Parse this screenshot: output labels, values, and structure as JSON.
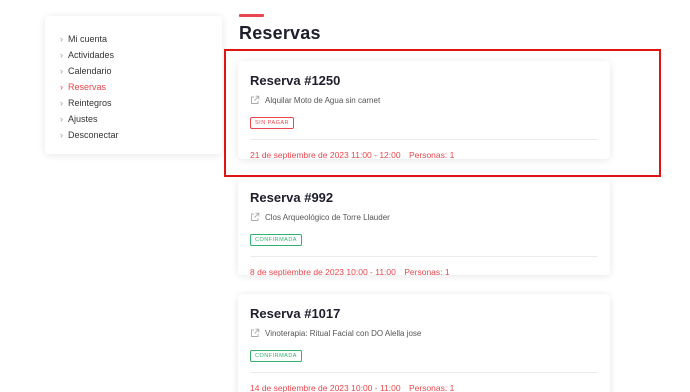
{
  "sidebar": {
    "items": [
      {
        "label": "Mi cuenta"
      },
      {
        "label": "Actividades"
      },
      {
        "label": "Calendario"
      },
      {
        "label": "Reservas"
      },
      {
        "label": "Reintegros"
      },
      {
        "label": "Ajustes"
      },
      {
        "label": "Desconectar"
      }
    ],
    "active_index": 3
  },
  "page": {
    "title": "Reservas"
  },
  "reservations": [
    {
      "title": "Reserva #1250",
      "activity": "Alquilar Moto de Agua sin carnet",
      "status": "SIN PAGAR",
      "date": "21 de septiembre de 2023 11:00 - 12:00",
      "persons": "Personas: 1"
    },
    {
      "title": "Reserva #992",
      "activity": "Clos Arqueológico de Torre Llauder",
      "status": "CONFIRMADA",
      "date": "8 de septiembre de 2023 10:00 - 11:00",
      "persons": "Personas: 1"
    },
    {
      "title": "Reserva #1017",
      "activity": "Vinoterapia: Ritual Facial con DO Alella jose",
      "status": "CONFIRMADA",
      "date": "14 de septiembre de 2023 10:00 - 11:00",
      "persons": "Personas: 1"
    }
  ],
  "colors": {
    "accent": "#e8474d",
    "confirmed": "#2fb36e",
    "highlight": "#e01414"
  },
  "icons": {
    "sidebar_chevron": "chevron-right-icon",
    "activity_link": "external-link-icon"
  }
}
